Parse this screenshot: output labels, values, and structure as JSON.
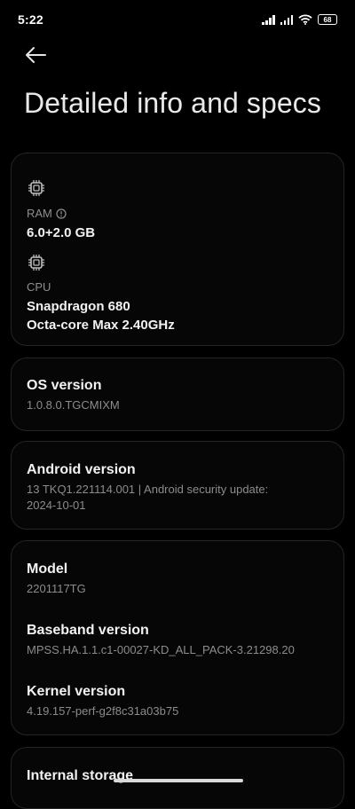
{
  "status_bar": {
    "time": "5:22",
    "battery": "68",
    "icons": [
      "signal-icon",
      "signal-icon",
      "wifi-icon",
      "battery-icon"
    ]
  },
  "header": {
    "back_icon": "arrow-left-icon",
    "title": "Detailed info and specs"
  },
  "specs": {
    "ram": {
      "icon": "chip-icon",
      "label": "RAM",
      "info_icon": "info-icon",
      "value": "6.0+2.0 GB"
    },
    "cpu": {
      "icon": "chip-icon",
      "label": "CPU",
      "value_line1": "Snapdragon 680",
      "value_line2": "Octa-core Max 2.40GHz"
    }
  },
  "os_version": {
    "title": "OS version",
    "value": "1.0.8.0.TGCMIXM"
  },
  "android_version": {
    "title": "Android version",
    "value_line1": "13 TKQ1.221114.001 | Android security update:",
    "value_line2": "2024-10-01"
  },
  "device_info": {
    "model": {
      "title": "Model",
      "value": "2201117TG"
    },
    "baseband": {
      "title": "Baseband version",
      "value": "MPSS.HA.1.1.c1-00027-KD_ALL_PACK-3.21298.20"
    },
    "kernel": {
      "title": "Kernel version",
      "value": "4.19.157-perf-g2f8c31a03b75"
    }
  },
  "storage": {
    "title": "Internal storage"
  }
}
